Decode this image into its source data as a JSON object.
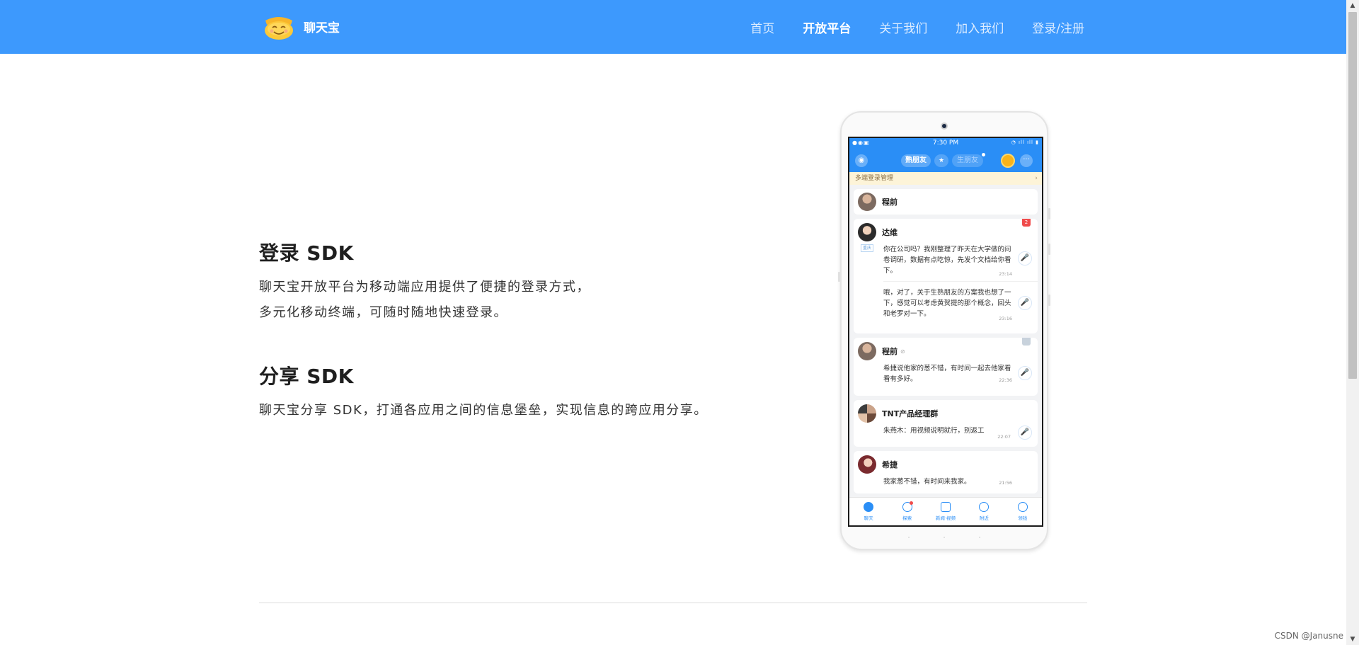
{
  "header": {
    "brand": "聊天宝",
    "nav": [
      "首页",
      "开放平台",
      "关于我们",
      "加入我们",
      "登录/注册"
    ],
    "active_index": 1
  },
  "sections": {
    "login": {
      "title": "登录 SDK",
      "lines": [
        "聊天宝开放平台为移动端应用提供了便捷的登录方式，",
        "多元化移动终端，可随时随地快速登录。"
      ]
    },
    "share": {
      "title": "分享 SDK",
      "lines": [
        "聊天宝分享 SDK，打通各应用之间的信息堡垒，实现信息的跨应用分享。"
      ]
    }
  },
  "phone": {
    "status_time": "7:30 PM",
    "appbar": {
      "tab_active": "熟朋友",
      "tab_inactive": "生朋友"
    },
    "notice": "多端登录管理",
    "chats": {
      "c1": {
        "name": "程前"
      },
      "c2": {
        "name": "达维",
        "badge": "2",
        "tag": "重庆",
        "msg1": "你在公司吗？我刚整理了昨天在大学做的问卷调研，数据有点吃惊，先发个文档给你看下。",
        "time1": "23:14",
        "msg2": "哦，对了，关于生熟朋友的方案我也想了一下，感觉可以考虑黄贺提的那个概念，回头和老罗对一下。",
        "time2": "23:16"
      },
      "c3": {
        "name": "程前",
        "msg": "希捷说他家的葱不错，有时间一起去他家看看有多好。",
        "time": "22:36"
      },
      "c4": {
        "name": "TNT产品经理群",
        "msg": "朱燕木：用视频说明就行，别返工",
        "time": "22:07"
      },
      "c5": {
        "name": "希捷",
        "msg": "我家葱不错，有时间来我家。",
        "time": "21:56"
      }
    },
    "tabs": [
      "聊天",
      "探索",
      "新闻·视频",
      "附近",
      "领钱"
    ]
  },
  "watermark": "CSDN @Janusne",
  "colors": {
    "header_bg": "#3d99fd",
    "phone_blue": "#2a8ef6",
    "text_dark": "#1f1f1f"
  }
}
